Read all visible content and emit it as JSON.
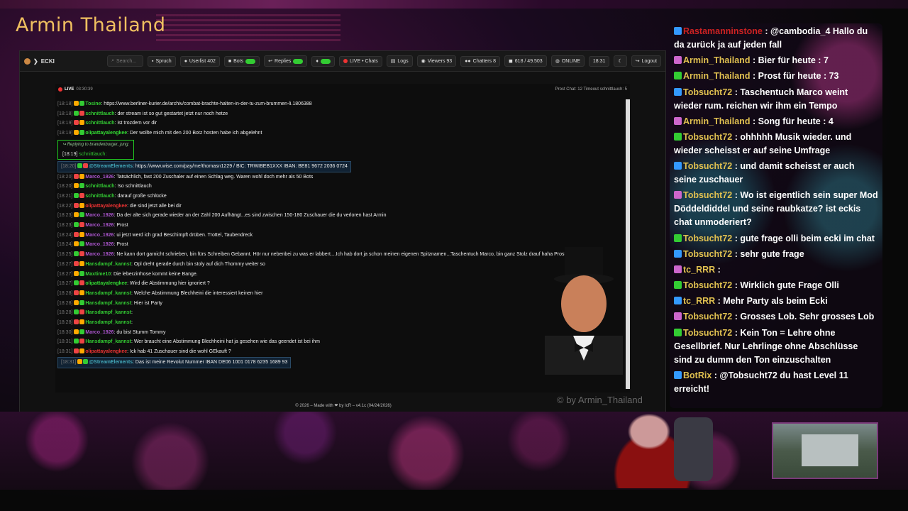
{
  "channel": {
    "title": "Armin Thailand"
  },
  "app": {
    "name": "ECKI",
    "search_placeholder": "Search...",
    "buttons": {
      "spruch": "Spruch",
      "userlist": "Userlist 402",
      "bots": "Bots",
      "replies": "Replies",
      "live_chats": "LIVE • Chats",
      "logs": "Logs",
      "viewers": "Viewers 93",
      "chatters": "Chatters 8",
      "messages": "618 / 49.503",
      "online": "ONLINE",
      "time": "18:31",
      "logout": "Logout"
    }
  },
  "chat": {
    "live_label": "LIVE",
    "live_time": "03:30:39",
    "stats": "Prost Chat: 12   Timeout schnittlauch: 5",
    "messages": [
      {
        "time": "[18:18]",
        "user": "Tosine",
        "color": "#3c3",
        "text": "https://www.berliner-kurier.de/archiv/combat-brachte-halten-in-der-tu-zum-brummen-li.1806388"
      },
      {
        "time": "[18:18]",
        "user": "schnittlauch",
        "color": "#3c3",
        "text": "der stream ist so gut gestartet jetzt nur noch hetze"
      },
      {
        "time": "[18:19]",
        "user": "schnittlauch",
        "color": "#3c3",
        "text": "ist trozdem vor dir"
      },
      {
        "time": "[18:19]",
        "user": "olipattayalengkee",
        "color": "#3d3",
        "text": "Der wollte mich mit den 200 Botz hosten habe ich abgelehnt"
      },
      {
        "time": "[18:20]",
        "user": "@StreamElements",
        "color": "#4ab",
        "text": "https://www.wise.com/pay/me/thomasn1229 / BIC: TRWIBEB1XXX IBAN: BE81 9672 2036 0724"
      },
      {
        "time": "[18:20]",
        "user": "Marco_1926",
        "color": "#a5c",
        "text": "Tatsächlich, fast 200 Zuschaler auf einen Schlag weg. Waren wohl doch mehr als 50 Bots"
      },
      {
        "time": "[18:20]",
        "user": "schnittlauch",
        "color": "#3c3",
        "text": "!so schnittlauch"
      },
      {
        "time": "[18:21]",
        "user": "schnittlauch",
        "color": "#3c3",
        "text": "darauf große schlücke"
      },
      {
        "time": "[18:22]",
        "user": "olipattayalengkee",
        "color": "#e33",
        "text": "die sind jetzt alle bei dir"
      },
      {
        "time": "[18:23]",
        "user": "Marco_1926",
        "color": "#a5c",
        "text": "Da der alte sich gerade wieder an der Zahl 200 Aufhängt...es sind zwischen 150-180 Zuschauer die du verloren hast Armin"
      },
      {
        "time": "[18:23]",
        "user": "Marco_1926",
        "color": "#a5c",
        "text": "Prost"
      },
      {
        "time": "[18:24]",
        "user": "Marco_1926",
        "color": "#a5c",
        "text": "ui jetzt werd ich grad Beschimpft drüben. Trottel, Taubendreck"
      },
      {
        "time": "[18:24]",
        "user": "Marco_1926",
        "color": "#a5c",
        "text": "Prost"
      },
      {
        "time": "[18:25]",
        "user": "Marco_1926",
        "color": "#a5c",
        "text": "Ne kann dort garnicht schrieben, bin fürs Schreiben Gebannt. Hör nur nebenbei zu was er labbert....Ich hab dort ja schon meinen eigenen Spitznamen...Taschentuch Marco, bin ganz Stolz drauf haha Prost"
      },
      {
        "time": "[18:27]",
        "user": "Hansdampf_kannst",
        "color": "#3c3",
        "text": "Opl dreht gerade durch      bin stoly auf dich Thommy weiter so"
      },
      {
        "time": "[18:27]",
        "user": "Maxtime10",
        "color": "#3c3",
        "text": "Die leberzirrhose kommt keine Bange."
      },
      {
        "time": "[18:27]",
        "user": "olipattayalengkee",
        "color": "#3d3",
        "text": "Wird die Abstimmung hier ignoriert ?"
      },
      {
        "time": "[18:28]",
        "user": "Hansdampf_kannst",
        "color": "#3c3",
        "text": "Welche Abstimmung Blechheini die interessiert keinen hier"
      },
      {
        "time": "[18:28]",
        "user": "Hansdampf_kannst",
        "color": "#3c3",
        "text": "Hier ist Party"
      },
      {
        "time": "[18:28]",
        "user": "Hansdampf_kannst",
        "color": "#3c3",
        "text": ""
      },
      {
        "time": "[18:28]",
        "user": "Hansdampf_kannst",
        "color": "#3c3",
        "text": ""
      },
      {
        "time": "[18:30]",
        "user": "Marco_1926",
        "color": "#a5c",
        "text": "du bist Stumm Tommy"
      },
      {
        "time": "[18:31]",
        "user": "Hansdampf_kannst",
        "color": "#3c3",
        "text": "Wer braucht eine Abstimmung Blechheini hat ja gesehen wie das geendet ist bei ihm"
      },
      {
        "time": "[18:31]",
        "user": "olipattayalengkee",
        "color": "#e33",
        "text": "Ick hab 41 Zuschauer sind die wohl GEkauft ?"
      },
      {
        "time": "[18:31]",
        "user": "@StreamElements",
        "color": "#4ab",
        "text": "Das ist meine Revolut Nummer IBAN DE06 1001 0178 6235 1689 93"
      }
    ],
    "reply": {
      "label": "Replying to",
      "target": "brandenburger_jung",
      "time": "[18:19]",
      "user": "schnittlauch"
    }
  },
  "watermark": "© by Armin_Thailand",
  "footer": "© 2026 – Made with ❤ by IcR – v4.1c (04/24/2026)",
  "overlay": {
    "messages": [
      {
        "user": "Rastamanninstone",
        "color": "#c22",
        "text": ": @cambodia_4 Hallo du da zurück ja auf jeden fall"
      },
      {
        "user": "Armin_Thailand",
        "color": "#e0c050",
        "text": ": Bier für heute : 7"
      },
      {
        "user": "Armin_Thailand",
        "color": "#e0c050",
        "text": ": Prost für heute : 73"
      },
      {
        "user": "Tobsucht72",
        "color": "#e0c050",
        "text": ": Taschentuch Marco weint wieder rum. reichen wir ihm ein Tempo"
      },
      {
        "user": "Armin_Thailand",
        "color": "#e0c050",
        "text": ": Song für heute : 4"
      },
      {
        "user": "Tobsucht72",
        "color": "#e0c050",
        "text": ": ohhhhh Musik wieder. und wieder scheisst er auf seine Umfrage"
      },
      {
        "user": "Tobsucht72",
        "color": "#e0c050",
        "text": ": und damit scheisst er auch seine zuschauer"
      },
      {
        "user": "Tobsucht72",
        "color": "#e0c050",
        "text": ": Wo ist eigentlich sein super Mod Döddeldiddel und seine raubkatze? ist eckis chat unmoderiert?"
      },
      {
        "user": "Tobsucht72",
        "color": "#e0c050",
        "text": ": gute frage olli beim ecki im chat"
      },
      {
        "user": "Tobsucht72",
        "color": "#e0c050",
        "text": ": sehr gute frage"
      },
      {
        "user": "tc_RRR",
        "color": "#e0c050",
        "text": ":"
      },
      {
        "user": "Tobsucht72",
        "color": "#e0c050",
        "text": ": Wirklich gute Frage Olli"
      },
      {
        "user": "tc_RRR",
        "color": "#e0c050",
        "text": ": Mehr Party als beim Ecki"
      },
      {
        "user": "Tobsucht72",
        "color": "#e0c050",
        "text": ": Grosses Lob. Sehr grosses Lob"
      },
      {
        "user": "Tobsucht72",
        "color": "#e0c050",
        "text": ": Kein Ton = Lehre ohne Gesellbrief. Nur Lehrlinge ohne Abschlüsse sind zu dumm den Ton einzuschalten"
      },
      {
        "user": "BotRix",
        "color": "#e0c050",
        "text": ": @Tobsucht72 du hast Level 11 erreicht!"
      }
    ]
  }
}
